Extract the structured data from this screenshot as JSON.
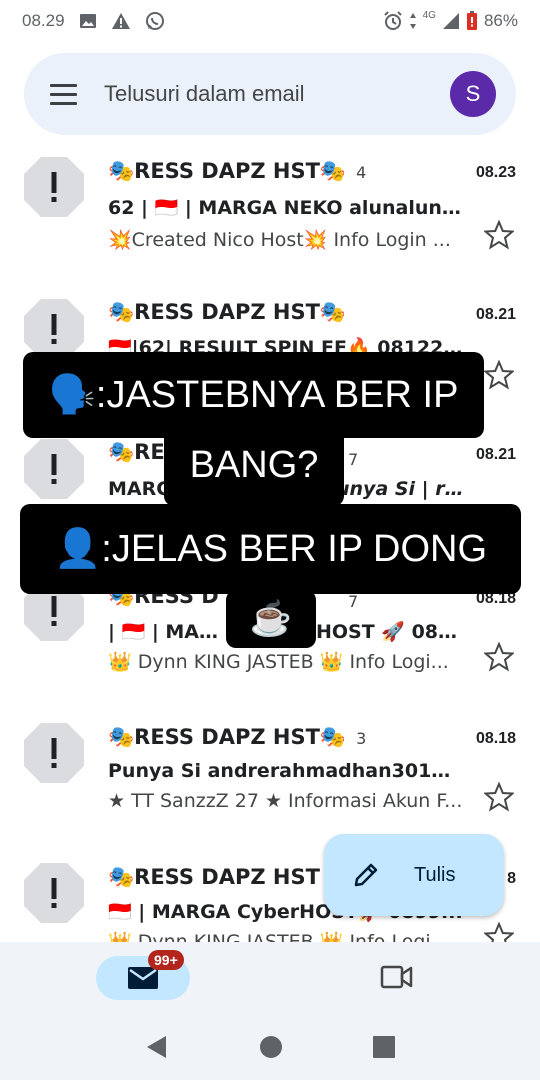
{
  "status_bar": {
    "time": "08.29",
    "network": "4G",
    "battery": "86%"
  },
  "search": {
    "placeholder": "Telusuri dalam email",
    "avatar_letter": "S"
  },
  "emails": [
    {
      "sender": "🎭RESS DAPZ HST🎭",
      "count": "4",
      "time": "08.23",
      "subject": "62 | 🇮🇩 | MARGA NEKO  alunalun2...",
      "snippet": "💥Created Nico Host💥 Info Login ..."
    },
    {
      "sender": "🎭RESS DAPZ HST🎭",
      "count": "",
      "time": "08.21",
      "subject": "🇮🇩|62| RESULT SPIN FF🔥 081225...",
      "snippet": ""
    },
    {
      "sender": "🎭RE",
      "count": "7",
      "time": "08.21",
      "subject": "MARG",
      "subject_tail": "unya Si | ra...",
      "snippet": ""
    },
    {
      "sender": "🎭RESS D",
      "count": "7",
      "time": "08.18",
      "subject": "| 🇮🇩 | MARG",
      "subject_tail": "HOST 🚀  089...",
      "snippet": "👑 Dynn KING JASTEB 👑 Info Logi..."
    },
    {
      "sender": "🎭RESS DAPZ HST🎭",
      "count": "3",
      "time": "08.18",
      "subject": "Punya Si andrerahmadhan301@g...",
      "snippet": "★ TT SanzzZ 27 ★ Informasi Akun F..."
    },
    {
      "sender": "🎭RESS DAPZ HST",
      "count": "",
      "time": "8",
      "subject": "🇮🇩 | MARGA CyberHOST🚀  0899...",
      "snippet": "👑 Dynn KING JASTEB 👑 Info Logi..."
    }
  ],
  "overlay": {
    "line1": "🗣️:JASTEBNYA BER IP",
    "line2": "BANG?",
    "line3": "👤:JELAS BER IP DONG",
    "line4": "☕"
  },
  "compose": {
    "label": "Tulis"
  },
  "bottom_nav": {
    "mail_badge": "99+"
  },
  "colors": {
    "search_bg": "#eaf1fb",
    "avatar": "#5b2aa8",
    "fab": "#c2e7ff",
    "badge": "#b3261e"
  }
}
